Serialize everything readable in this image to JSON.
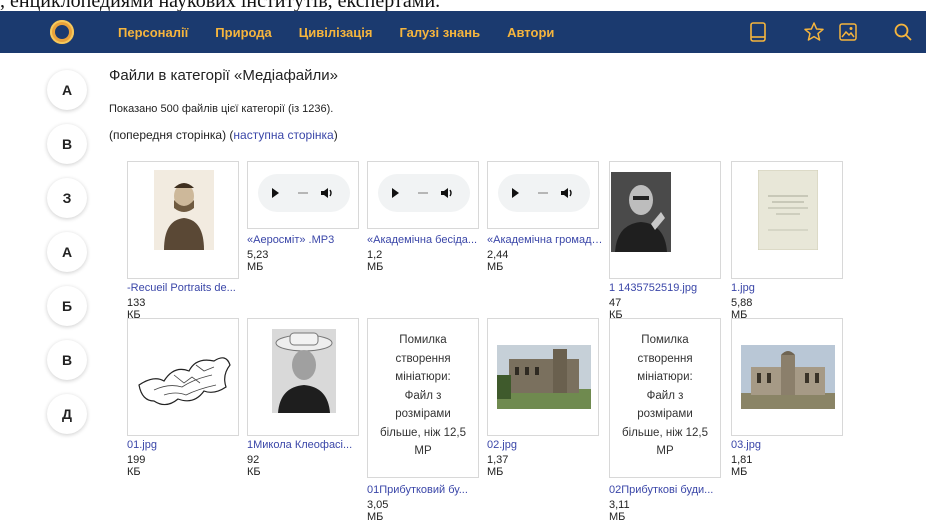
{
  "top_cut_text": ", енциклопедиями наукових інститутів, експертами.",
  "nav": {
    "items": [
      "Персоналії",
      "Природа",
      "Цивілізація",
      "Галузі знань",
      "Автори"
    ],
    "icons": [
      "book-icon",
      "star-icon",
      "image-icon",
      "search-icon"
    ],
    "accent": "#f6b53d",
    "bg": "#1b3a6f"
  },
  "letters": [
    "А",
    "В",
    "З",
    "А",
    "Б",
    "В",
    "Д"
  ],
  "page": {
    "title": "Файли в категорії «Медіафайли»",
    "count": "Показано 500 файлів цієї категорії (із 1236).",
    "prev": "(попередня сторінка)",
    "next_open": "(",
    "next": "наступна сторінка",
    "next_close": ")"
  },
  "files": [
    {
      "name": "-Recueil Portraits de...",
      "size": "133 КБ",
      "type": "portrait-engraving"
    },
    {
      "name": "«Аеросміт» .MP3",
      "size": "5,23 МБ",
      "type": "audio"
    },
    {
      "name": "«Академічна бесіда...",
      "size": "1,2 МБ",
      "type": "audio"
    },
    {
      "name": "«Академічна громада...",
      "size": "2,44 МБ",
      "type": "audio"
    },
    {
      "name": "1 1435752519.jpg",
      "size": "47 КБ",
      "type": "portrait-photo"
    },
    {
      "name": "1.jpg",
      "size": "5,88 МБ",
      "type": "document"
    },
    {
      "name": "01.jpg",
      "size": "199 КБ",
      "type": "map"
    },
    {
      "name": "1Микола Клеофасі...",
      "size": "92 КБ",
      "type": "portrait-hat"
    },
    {
      "name": "01Прибутковий бу...",
      "size": "3,05 МБ",
      "type": "error",
      "error": [
        "Помилка",
        "створення",
        "мініатюри:",
        "Файл з",
        "розмірами",
        "більше, ніж 12,5",
        "MP"
      ]
    },
    {
      "name": "02.jpg",
      "size": "1,37 МБ",
      "type": "palace"
    },
    {
      "name": "02Прибуткові буди...",
      "size": "3,11 МБ",
      "type": "error",
      "error": [
        "Помилка",
        "створення",
        "мініатюри:",
        "Файл з",
        "розмірами",
        "більше, ніж 12,5",
        "MP"
      ]
    },
    {
      "name": "03.jpg",
      "size": "1,81 МБ",
      "type": "palace2"
    }
  ]
}
